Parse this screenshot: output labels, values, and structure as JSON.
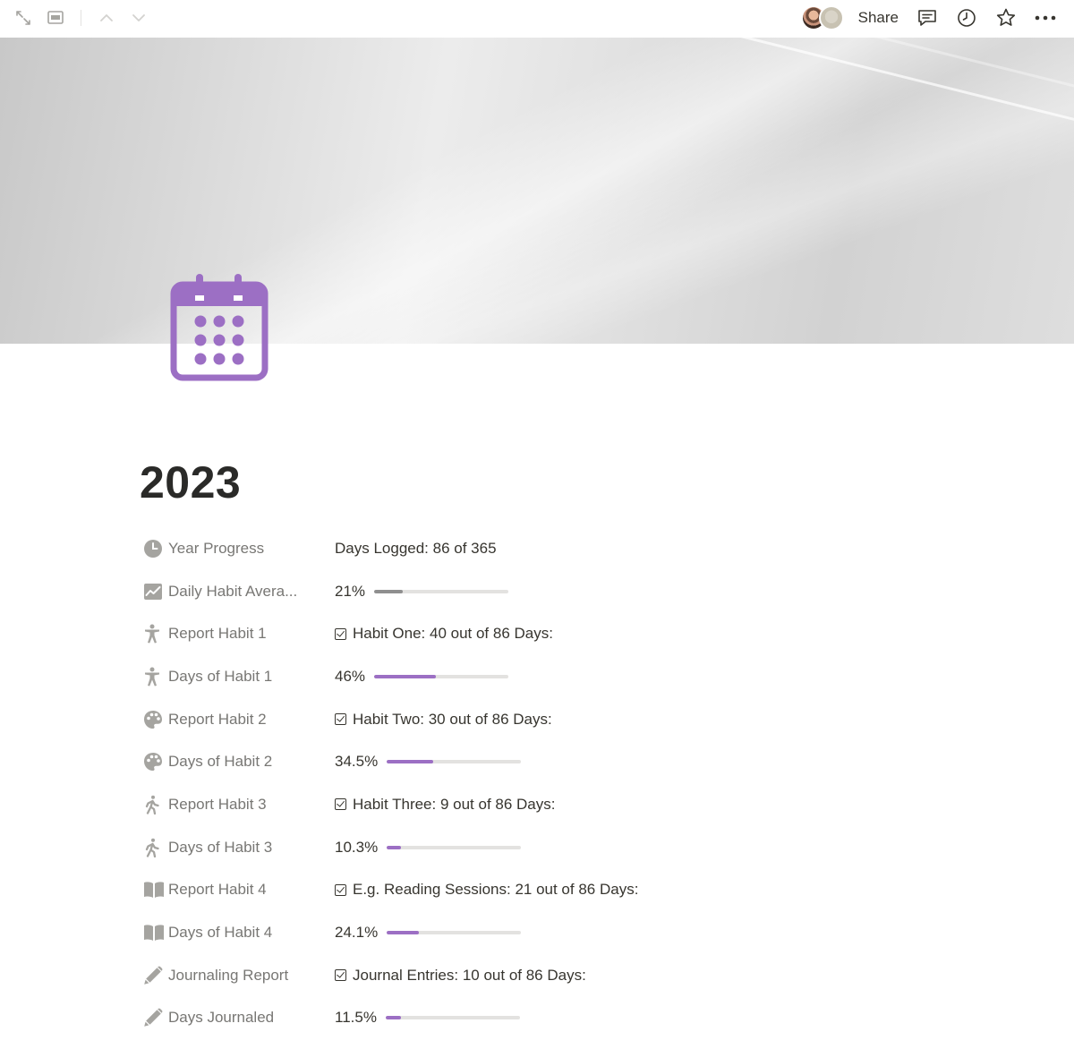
{
  "colors": {
    "accent_purple": "#9c6fc4",
    "gray_bar": "#8f8f8f",
    "track": "#e3e2e0",
    "icon_gray": "#a5a4a0"
  },
  "topbar": {
    "share_label": "Share",
    "left_icons": [
      "expand-icon",
      "sidebar-panel-icon",
      "chevron-up-icon",
      "chevron-down-icon"
    ],
    "right_icons": [
      "comment-icon",
      "clock-icon",
      "star-icon",
      "more-icon"
    ]
  },
  "page": {
    "icon": "calendar-icon",
    "title": "2023"
  },
  "properties": [
    {
      "icon": "clock-icon",
      "label": "Year Progress",
      "type": "text",
      "value": "Days Logged: 86 of 365"
    },
    {
      "icon": "chart-icon",
      "label": "Daily Habit Avera...",
      "type": "progress",
      "value": "21%",
      "progress": 21,
      "color": "#8f8f8f"
    },
    {
      "icon": "accessibility-icon",
      "label": "Report Habit 1",
      "type": "check",
      "value": "Habit One: 40 out of 86 Days:"
    },
    {
      "icon": "accessibility-icon",
      "label": "Days of Habit 1",
      "type": "progress",
      "value": "46%",
      "progress": 46,
      "color": "#9c6fc4"
    },
    {
      "icon": "palette-icon",
      "label": "Report Habit 2",
      "type": "check",
      "value": "Habit Two: 30 out of 86 Days:"
    },
    {
      "icon": "palette-icon",
      "label": "Days of Habit 2",
      "type": "progress",
      "value": "34.5%",
      "progress": 34.5,
      "color": "#9c6fc4"
    },
    {
      "icon": "walking-icon",
      "label": "Report Habit 3",
      "type": "check",
      "value": "Habit Three: 9 out of 86 Days:"
    },
    {
      "icon": "walking-icon",
      "label": "Days of Habit 3",
      "type": "progress",
      "value": "10.3%",
      "progress": 10.3,
      "color": "#9c6fc4"
    },
    {
      "icon": "book-icon",
      "label": "Report Habit 4",
      "type": "check",
      "value": "E.g. Reading Sessions: 21 out of 86 Days:"
    },
    {
      "icon": "book-icon",
      "label": "Days of Habit 4",
      "type": "progress",
      "value": "24.1%",
      "progress": 24.1,
      "color": "#9c6fc4"
    },
    {
      "icon": "pencil-icon",
      "label": "Journaling Report",
      "type": "check",
      "value": "Journal Entries: 10 out of 86 Days:"
    },
    {
      "icon": "pencil-icon",
      "label": "Days Journaled",
      "type": "progress",
      "value": "11.5%",
      "progress": 11.5,
      "color": "#9c6fc4"
    }
  ]
}
